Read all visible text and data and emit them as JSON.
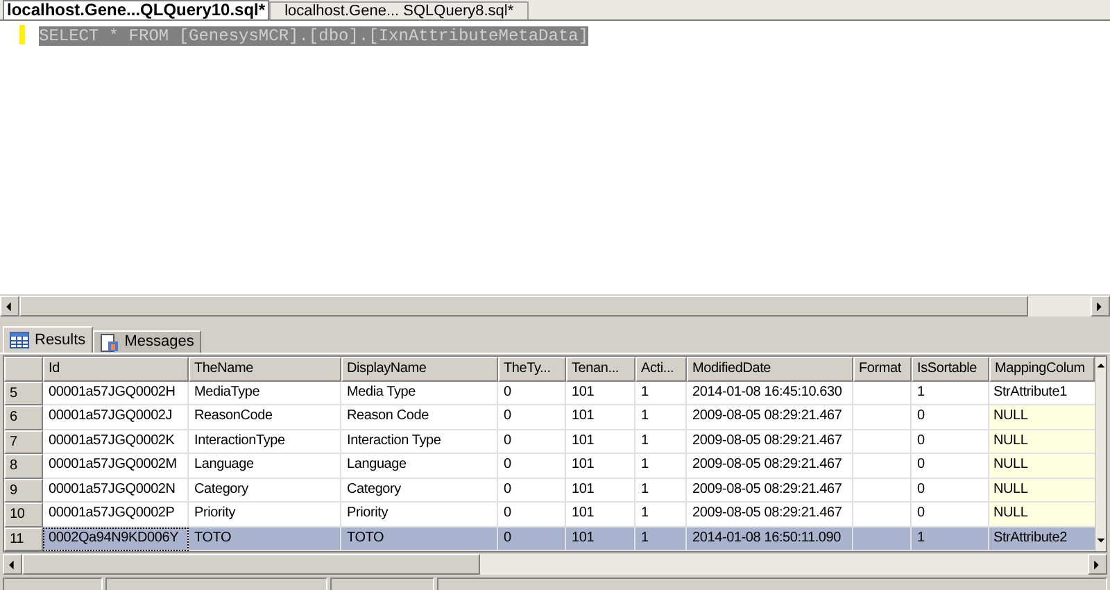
{
  "editor_tabs": [
    {
      "label": "localhost.Gene...QLQuery10.sql*",
      "selected": true
    },
    {
      "label": "localhost.Gene... SQLQuery8.sql*",
      "selected": false
    }
  ],
  "editor": {
    "query": "SELECT * FROM [GenesysMCR].[dbo].[IxnAttributeMetaData]"
  },
  "result_tabs": [
    {
      "label": "Results",
      "kind": "grid",
      "selected": true
    },
    {
      "label": "Messages",
      "kind": "messages",
      "selected": false
    }
  ],
  "table": {
    "columns": [
      "Id",
      "TheName",
      "DisplayName",
      "TheTy...",
      "Tenan...",
      "Acti...",
      "ModifiedDate",
      "Format",
      "IsSortable",
      "MappingColum"
    ],
    "rows": [
      {
        "header": "5",
        "selected": false,
        "cells": [
          "00001a57JGQ0002H",
          "MediaType",
          "Media Type",
          "0",
          "101",
          "1",
          "2014-01-08 16:45:10.630",
          "",
          "1"
        ],
        "mapping": {
          "text": "StrAttribute1",
          "kind": "value"
        }
      },
      {
        "header": "6",
        "selected": false,
        "cells": [
          "00001a57JGQ0002J",
          "ReasonCode",
          "Reason Code",
          "0",
          "101",
          "1",
          "2009-08-05 08:29:21.467",
          "",
          "0"
        ],
        "mapping": {
          "text": "NULL",
          "kind": "null"
        }
      },
      {
        "header": "7",
        "selected": false,
        "cells": [
          "00001a57JGQ0002K",
          "InteractionType",
          "Interaction Type",
          "0",
          "101",
          "1",
          "2009-08-05 08:29:21.467",
          "",
          "0"
        ],
        "mapping": {
          "text": "NULL",
          "kind": "null"
        }
      },
      {
        "header": "8",
        "selected": false,
        "cells": [
          "00001a57JGQ0002M",
          "Language",
          "Language",
          "0",
          "101",
          "1",
          "2009-08-05 08:29:21.467",
          "",
          "0"
        ],
        "mapping": {
          "text": "NULL",
          "kind": "null"
        }
      },
      {
        "header": "9",
        "selected": false,
        "cells": [
          "00001a57JGQ0002N",
          "Category",
          "Category",
          "0",
          "101",
          "1",
          "2009-08-05 08:29:21.467",
          "",
          "0"
        ],
        "mapping": {
          "text": "NULL",
          "kind": "null"
        }
      },
      {
        "header": "10",
        "selected": false,
        "cells": [
          "00001a57JGQ0002P",
          "Priority",
          "Priority",
          "0",
          "101",
          "1",
          "2009-08-05 08:29:21.467",
          "",
          "0"
        ],
        "mapping": {
          "text": "NULL",
          "kind": "null"
        }
      },
      {
        "header": "11",
        "selected": true,
        "cells": [
          "0002Qa94N9KD006Y",
          "TOTO",
          "TOTO",
          "0",
          "101",
          "1",
          "2014-01-08 16:50:11.090",
          "",
          "1"
        ],
        "mapping": {
          "text": "StrAttribute2",
          "kind": "value"
        }
      }
    ]
  }
}
